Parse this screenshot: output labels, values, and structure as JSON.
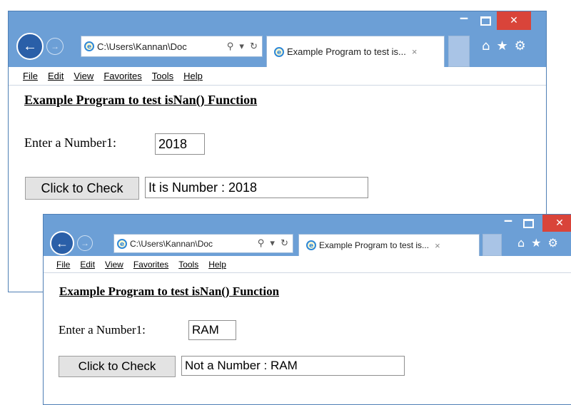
{
  "windows": [
    {
      "address": "C:\\Users\\Kannan\\Doc",
      "address_tools": "⚲ ▾ ↻",
      "tab_title": "Example Program to test is...",
      "tab_close": "×",
      "menu": [
        "File",
        "Edit",
        "View",
        "Favorites",
        "Tools",
        "Help"
      ],
      "heading": "Example Program to test isNan() Function",
      "input_label": "Enter a Number1:",
      "input_value": "2018",
      "button_label": "Click to Check",
      "result_value": "It is Number : 2018"
    },
    {
      "address": "C:\\Users\\Kannan\\Doc",
      "address_tools": "⚲ ▾ ↻",
      "tab_title": "Example Program to test is...",
      "tab_close": "×",
      "menu": [
        "File",
        "Edit",
        "View",
        "Favorites",
        "Tools",
        "Help"
      ],
      "heading": "Example Program to test isNan() Function",
      "input_label": "Enter a Number1:",
      "input_value": "RAM",
      "button_label": "Click to Check",
      "result_value": "Not a Number : RAM"
    }
  ],
  "chrome": {
    "minimize": "‒",
    "close": "✕",
    "back_glyph": "←",
    "forward_glyph": "→",
    "ie_glyph": "e",
    "home_icon": "⌂",
    "star_icon": "★",
    "gear_icon": "⚙"
  },
  "colors": {
    "frame": "#6c9fd6",
    "close_button": "#d9443a",
    "back_button": "#2a5fa8"
  }
}
